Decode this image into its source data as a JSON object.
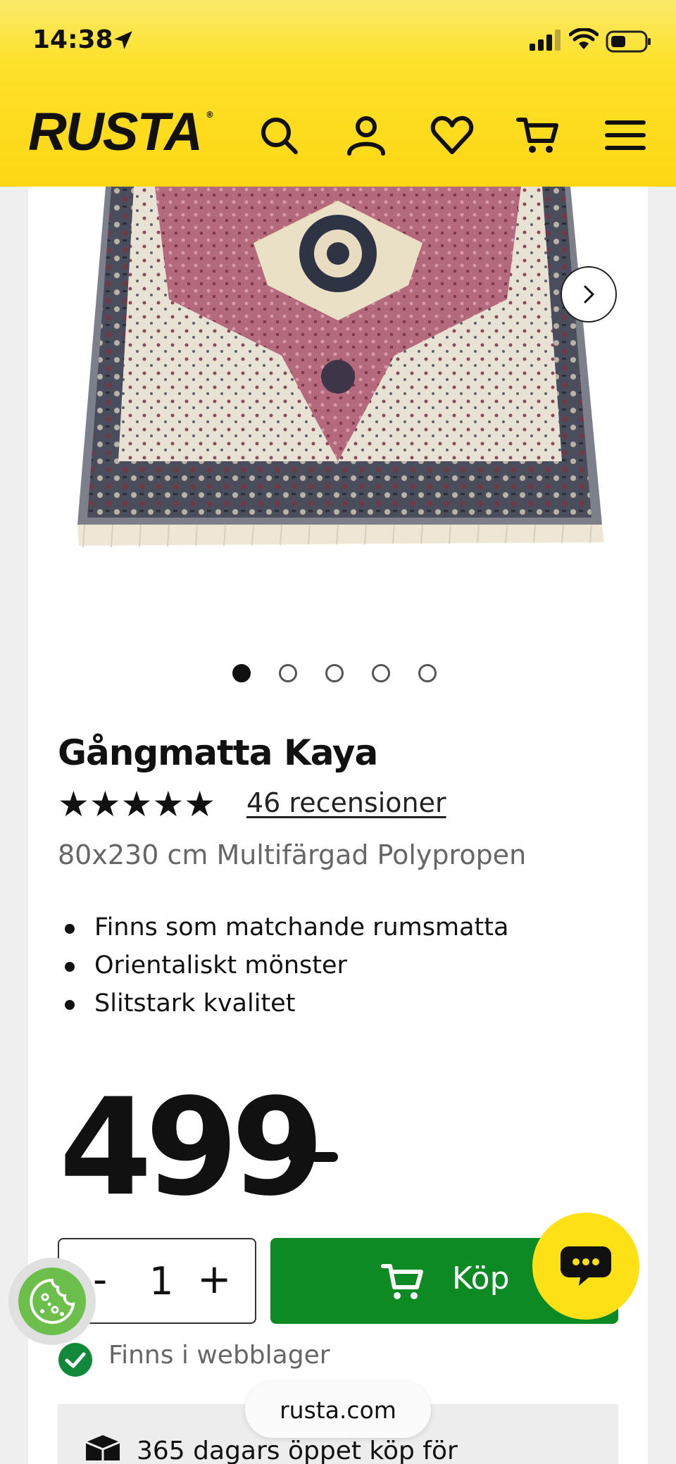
{
  "status_bar": {
    "time": "14:38"
  },
  "header": {
    "logo": "RUSTA",
    "logo_mark": "®",
    "icons": [
      "search-icon",
      "account-icon",
      "heart-icon",
      "cart-icon",
      "menu-icon"
    ]
  },
  "gallery": {
    "total_images": 5,
    "active_index": 0
  },
  "product": {
    "title": "Gångmatta Kaya",
    "stars": "★★★★★",
    "rating": 5,
    "reviews": "46 recensioner",
    "subtitle": "80x230 cm Multifärgad Polypropen",
    "features": [
      "Finns som matchande rumsmatta",
      "Orientaliskt mönster",
      "Slitstark kvalitet"
    ],
    "price": "499"
  },
  "purchase": {
    "minus": "-",
    "quantity": "1",
    "plus": "+",
    "buy_label": "Köp"
  },
  "stock": {
    "text": "Finns i webblager"
  },
  "returns": {
    "text": "365 dagars öppet köp för"
  },
  "browser": {
    "url": "rusta.com"
  },
  "colors": {
    "brand_yellow": "#fde016",
    "buy_green": "#0d8a24",
    "stock_green": "#12893a"
  }
}
